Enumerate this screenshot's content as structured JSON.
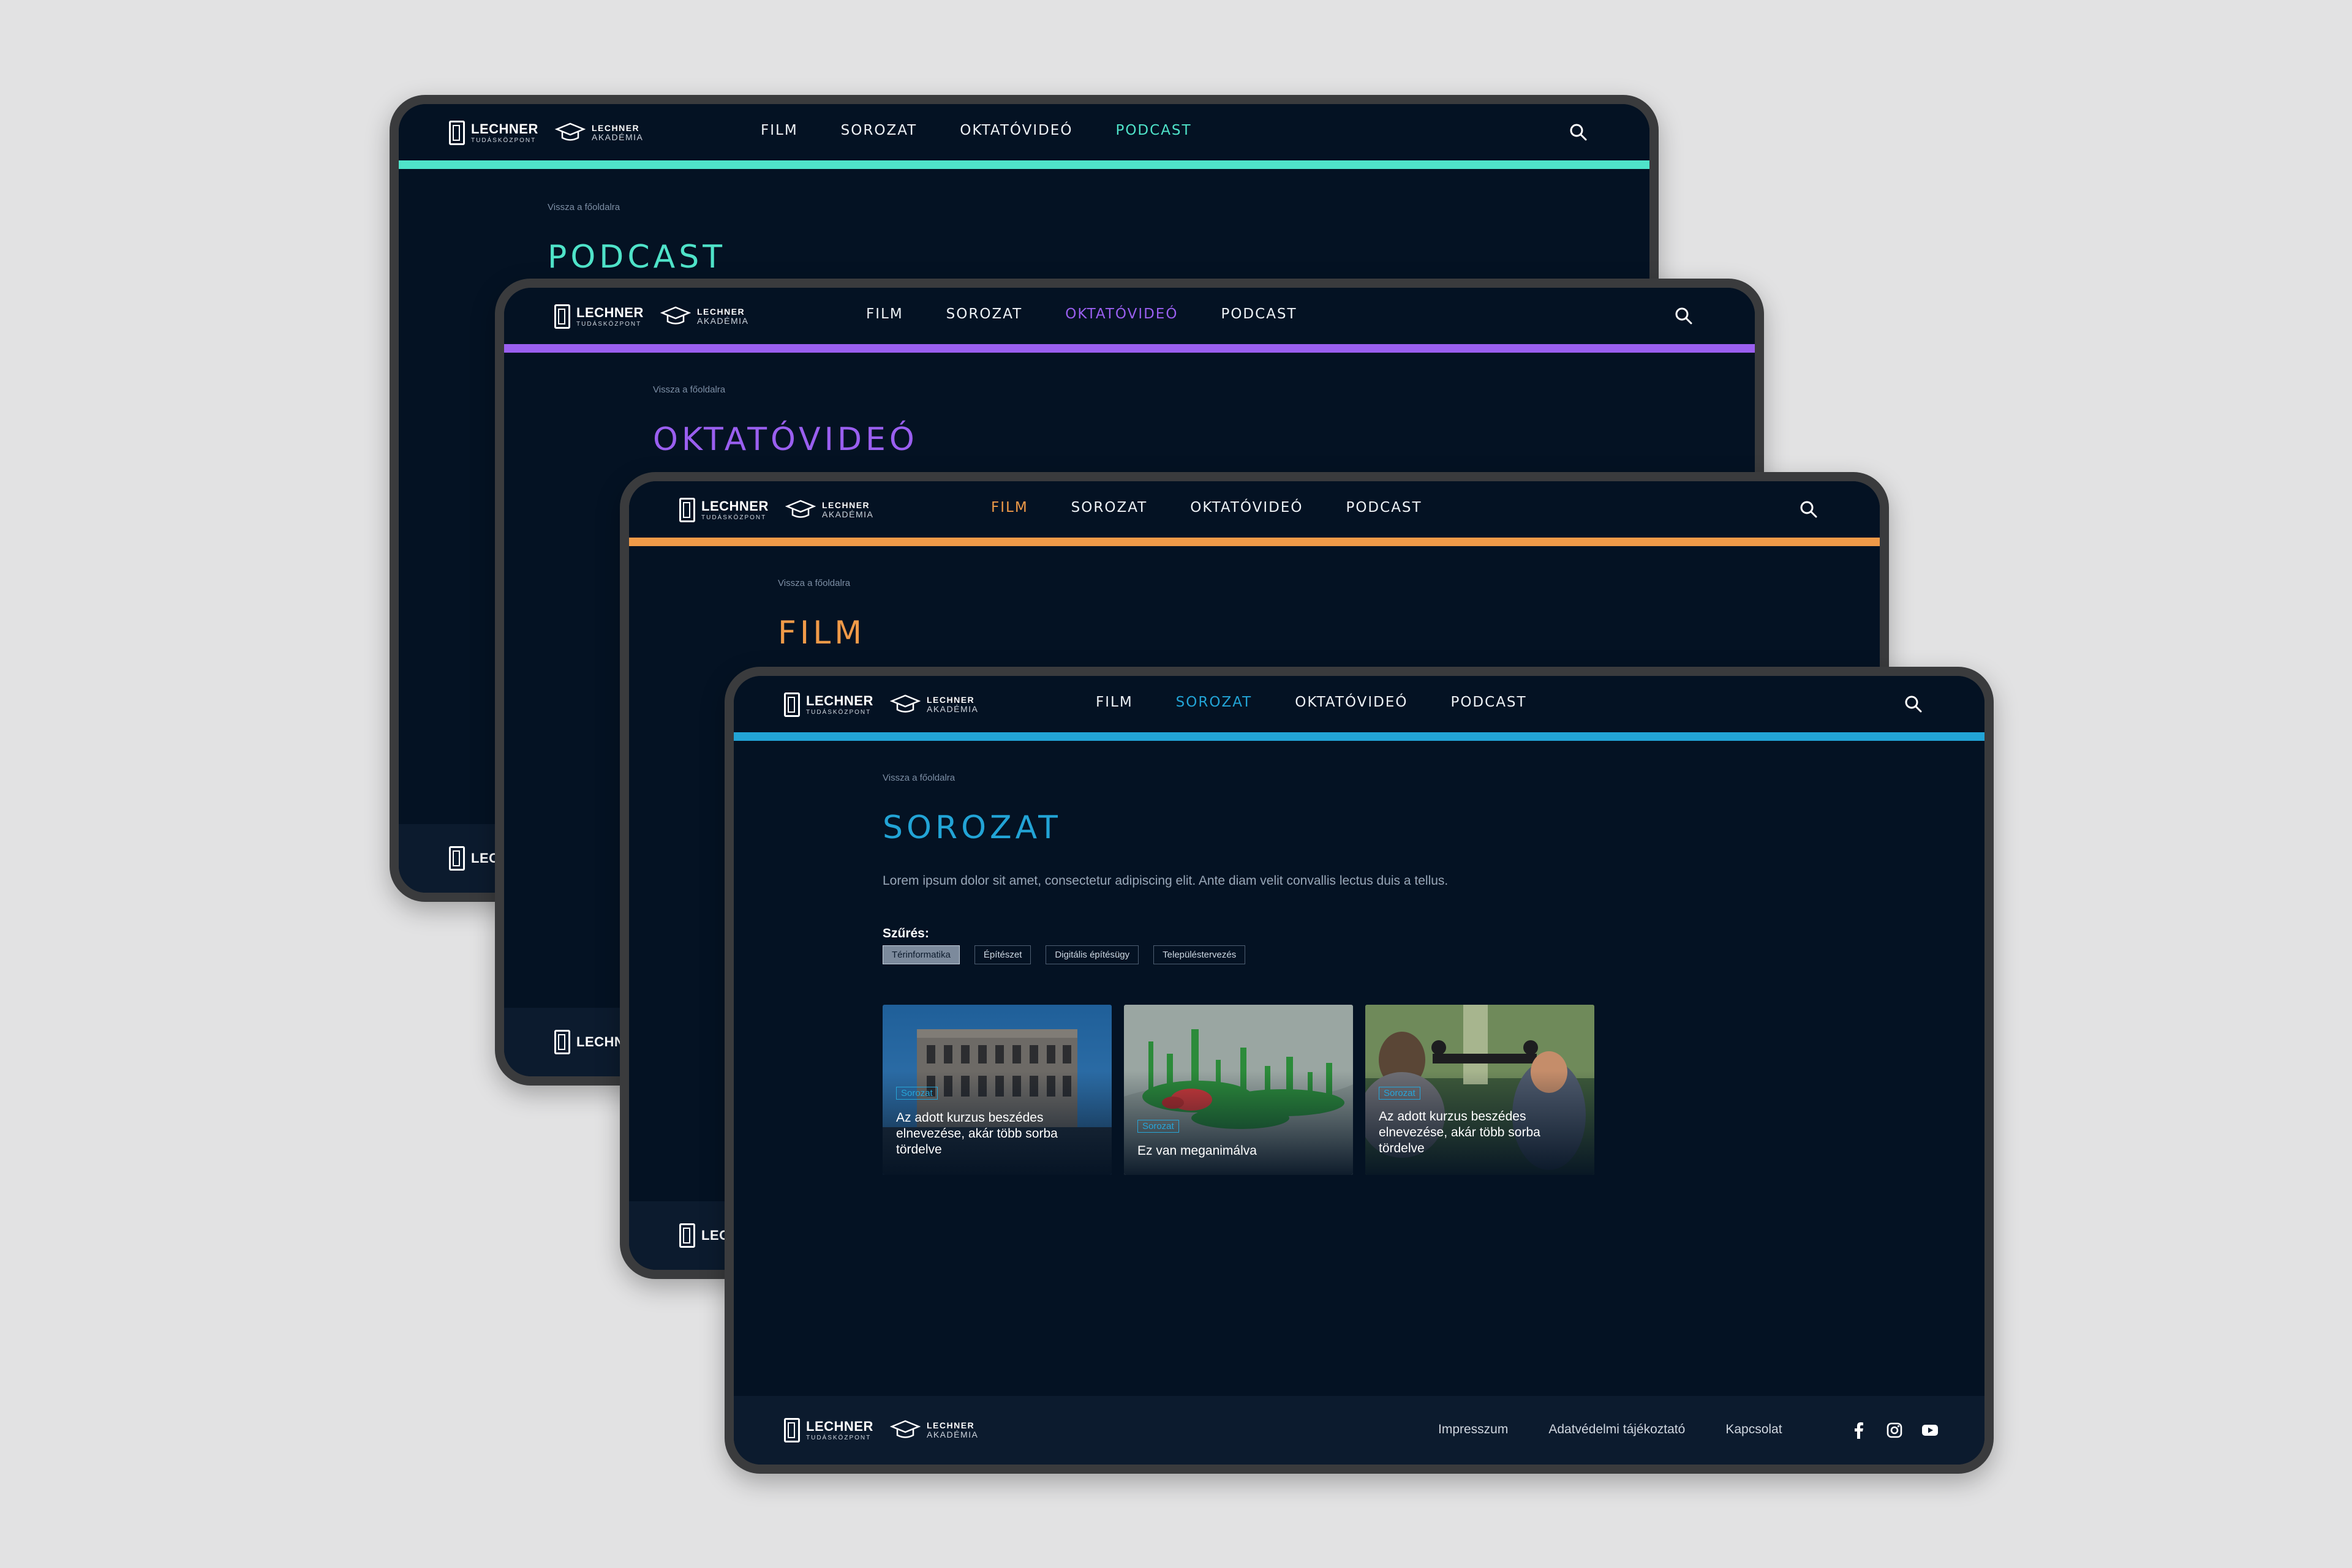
{
  "brand": {
    "tudaskozpont_title": "LECHNER",
    "tudaskozpont_sub": "TUDÁSKÖZPONT",
    "akademia_title": "LECHNER",
    "akademia_sub": "AKADÉMIA"
  },
  "nav": {
    "items": [
      "FILM",
      "SOROZAT",
      "OKTATÓVIDEÓ",
      "PODCAST"
    ]
  },
  "colors": {
    "background": "#e2e2e3",
    "page_bg": "#041223",
    "footer_bg": "#0c1b2e",
    "podcast": "#4fe3c9",
    "oktatovideo": "#9a5ff0",
    "film": "#f09a48",
    "sorozat": "#22a4d6"
  },
  "screens": {
    "podcast": {
      "active_nav": "PODCAST",
      "breadcrumb": "Vissza a főoldalra",
      "title": "PODCAST",
      "footer_logo_partial": "LECH"
    },
    "oktatovideo": {
      "active_nav": "OKTATÓVIDEÓ",
      "breadcrumb": "Vissza a főoldalra",
      "title": "OKTATÓVIDEÓ",
      "footer_logo_partial": "LECHN"
    },
    "film": {
      "active_nav": "FILM",
      "breadcrumb": "Vissza a főoldalra",
      "title": "FILM",
      "footer_logo_partial": "LEC"
    },
    "sorozat": {
      "active_nav": "SOROZAT",
      "breadcrumb": "Vissza a főoldalra",
      "title": "SOROZAT",
      "intro": "Lorem ipsum dolor sit amet, consectetur adipiscing elit. Ante diam velit convallis lectus duis a tellus.",
      "filter_label": "Szűrés:",
      "filters": [
        {
          "label": "Térinformatika",
          "active": true
        },
        {
          "label": "Építészet",
          "active": false
        },
        {
          "label": "Digitális építésügy",
          "active": false
        },
        {
          "label": "Településtervezés",
          "active": false
        }
      ],
      "cards": [
        {
          "tag": "Sorozat",
          "title": "Az adott kurzus beszédes elnevezése, akár több sorba tördelve"
        },
        {
          "tag": "Sorozat",
          "title": "Ez van meganimálva"
        },
        {
          "tag": "Sorozat",
          "title": "Az adott kurzus beszédes elnevezése, akár több sorba tördelve"
        }
      ],
      "footer_links": [
        "Impresszum",
        "Adatvédelmi tájékoztató",
        "Kapcsolat"
      ],
      "socials": [
        "facebook-icon",
        "instagram-icon",
        "youtube-icon"
      ]
    }
  }
}
